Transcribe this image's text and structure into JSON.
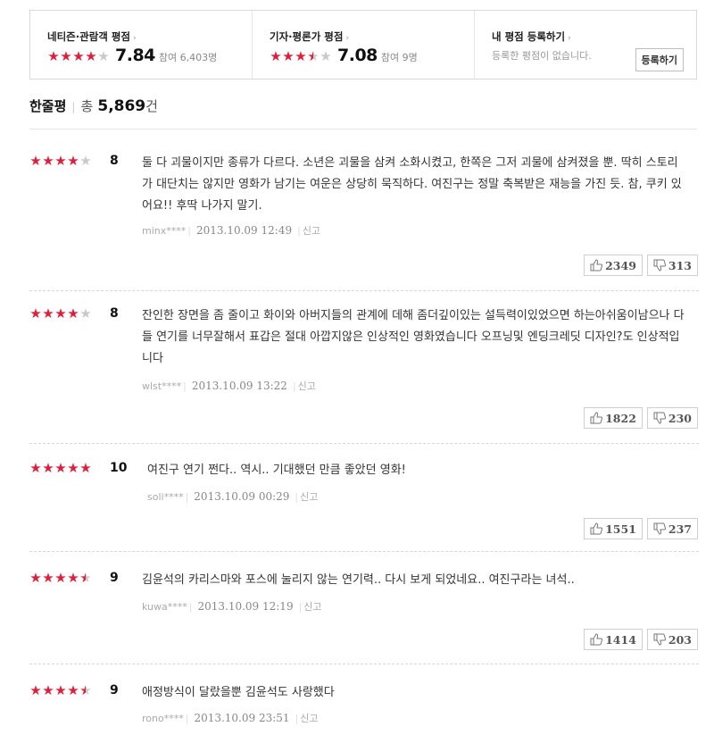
{
  "summary": {
    "netizen": {
      "title": "네티즌·관람객 평점",
      "score": "7.84",
      "participants": "참여 6,403명",
      "stars": [
        1,
        1,
        1,
        1,
        0
      ]
    },
    "critic": {
      "title": "기자·평론가 평점",
      "score": "7.08",
      "participants": "참여 9명",
      "stars": [
        1,
        1,
        1,
        0.5,
        0
      ]
    },
    "my": {
      "title": "내 평점 등록하기",
      "empty_text": "등록한 평점이 없습니다.",
      "button_label": "등록하기"
    },
    "caret": "›"
  },
  "total": {
    "label": "한줄평",
    "prefix": "총",
    "count": "5,869",
    "suffix": "건"
  },
  "star_colors": {
    "on": "#e11d3c",
    "off": "#c9c9c9"
  },
  "reviews": [
    {
      "stars": [
        1,
        1,
        1,
        1,
        0
      ],
      "score": "8",
      "text": "둘 다 괴물이지만 종류가 다르다. 소년은 괴물을 삼켜 소화시켰고, 한쪽은 그저 괴물에 삼켜졌을 뿐. 딱히 스토리가 대단치는 않지만 영화가 남기는 여운은 상당히 묵직하다. 여진구는 정말 축복받은 재능을 가진 듯. 참, 쿠키 있어요!! 후딱 나가지 말기.",
      "user": "minx****",
      "date": "2013.10.09 12:49",
      "report": "신고",
      "likes": "2349",
      "dislikes": "313"
    },
    {
      "stars": [
        1,
        1,
        1,
        1,
        0
      ],
      "score": "8",
      "text": "잔인한 장면을 좀 줄이고 화이와 아버지들의 관계에 데해 좀더깊이있는 설득력이있었으면 하는아쉬움이남으나 다들 연기를 너무잘해서 표갑은 절대 아깝지않은 인상적인 영화였습니다 오프닝및 엔딩크레딧 디자인?도 인상적입니다",
      "user": "wlst****",
      "date": "2013.10.09 13:22",
      "report": "신고",
      "likes": "1822",
      "dislikes": "230"
    },
    {
      "stars": [
        1,
        1,
        1,
        1,
        1
      ],
      "score": "10",
      "text": "여진구 연기 쩐다.. 역시.. 기대했던 만큼 좋았던 영화!",
      "user": "soli****",
      "date": "2013.10.09 00:29",
      "report": "신고",
      "likes": "1551",
      "dislikes": "237"
    },
    {
      "stars": [
        1,
        1,
        1,
        1,
        0.5
      ],
      "score": "9",
      "text": "김윤석의 카리스마와 포스에 눌리지 않는 연기력.. 다시 보게 되었네요.. 여진구라는 녀석..",
      "user": "kuwa****",
      "date": "2013.10.09 12:19",
      "report": "신고",
      "likes": "1414",
      "dislikes": "203"
    },
    {
      "stars": [
        1,
        1,
        1,
        1,
        0.5
      ],
      "score": "9",
      "text": "애정방식이 달랐을뿐 김윤석도 사랑했다",
      "user": "rono****",
      "date": "2013.10.09 23:51",
      "report": "신고"
    }
  ]
}
